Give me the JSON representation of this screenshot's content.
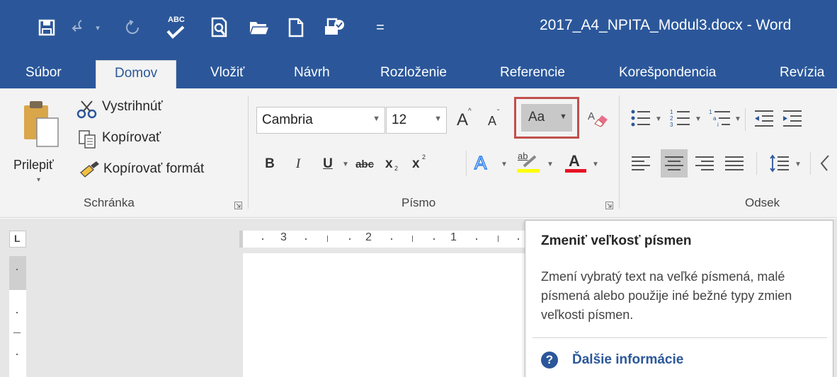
{
  "window": {
    "document_title": "2017_A4_NPITA_Modul3.docx - Word",
    "qat_icons": [
      "save-icon",
      "undo-icon",
      "undo-dropdown-icon",
      "redo-icon",
      "spelling-abc-icon",
      "print-preview-icon",
      "open-folder-icon",
      "new-document-icon",
      "check-document-icon",
      "customize-qat-icon"
    ],
    "spelling_icon_text": "ABC",
    "customize_glyph": "="
  },
  "tabs": [
    {
      "label": "Súbor"
    },
    {
      "label": "Domov"
    },
    {
      "label": "Vložiť"
    },
    {
      "label": "Návrh"
    },
    {
      "label": "Rozloženie"
    },
    {
      "label": "Referencie"
    },
    {
      "label": "Korešpondencia"
    },
    {
      "label": "Revízia"
    }
  ],
  "ribbon": {
    "clipboard": {
      "paste_label": "Prilepiť",
      "cut_label": "Vystrihnúť",
      "copy_label": "Kopírovať",
      "format_painter_label": "Kopírovať formát",
      "group_label": "Schránka"
    },
    "font": {
      "font_name": "Cambria",
      "font_size": "12",
      "grow_font_glyph": "A",
      "shrink_font_glyph": "A",
      "change_case_label": "Aa",
      "bold": "B",
      "italic": "I",
      "underline": "U",
      "strikethrough": "abc",
      "subscript": "x",
      "subscript_mark": "2",
      "superscript": "x",
      "superscript_mark": "2",
      "text_effects_glyph": "A",
      "highlight_glyph": "ab",
      "font_color_glyph": "A",
      "group_label": "Písmo",
      "colors": {
        "highlight": "#ffff00",
        "font_color": "#e81123",
        "change_case_highlight_border": "#c0504d"
      }
    },
    "paragraph": {
      "group_label": "Odsek"
    }
  },
  "ruler": {
    "numbers": [
      "3",
      "2",
      "1"
    ],
    "corner_glyph": "L"
  },
  "tooltip": {
    "title": "Zmeniť veľkosť písmen",
    "body": "Zmení vybratý text na veľké písmená, malé písmená alebo použije iné bežné typy zmien veľkosti písmen.",
    "help_glyph": "?",
    "help_link": "Ďalšie informácie"
  },
  "theme": {
    "accent": "#2b579a",
    "ribbon_bg": "#f3f3f3"
  }
}
